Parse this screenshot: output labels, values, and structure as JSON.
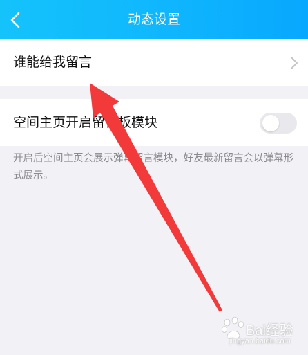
{
  "header": {
    "title": "动态设置",
    "back_icon": "chevron-left-icon"
  },
  "settings": {
    "who_can_leave_message": {
      "label": "谁能给我留言",
      "icon": "chevron-right-icon"
    },
    "guestbook_module": {
      "label": "空间主页开启留言板模块",
      "enabled": false,
      "description": "开启后空间主页会展示弹幕留言模块，好友最新留言会以弹幕形式展示。"
    }
  },
  "annotation": {
    "arrow_color": "#f23a3a"
  },
  "watermark": {
    "text": "Bai经验",
    "url": "jingyan.baidu.com"
  },
  "colors": {
    "header_start": "#15c3fb",
    "header_end": "#08a8fe",
    "background": "#f2f2f6",
    "toggle_off": "#e8e8ed"
  }
}
